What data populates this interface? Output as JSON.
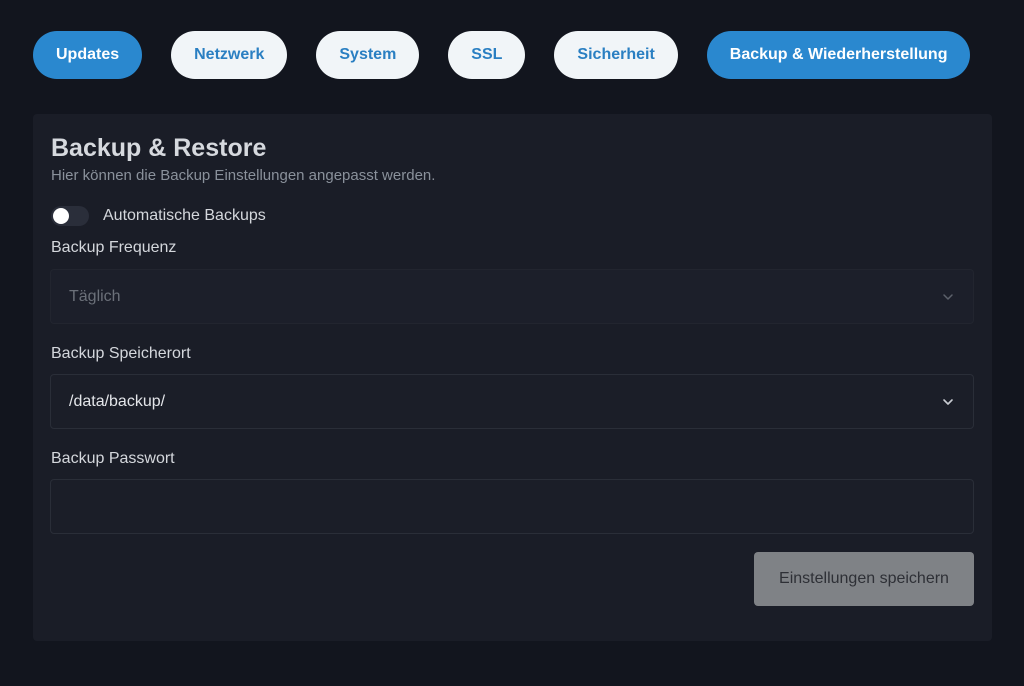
{
  "tabs": [
    {
      "label": "Updates",
      "style": "filled"
    },
    {
      "label": "Netzwerk",
      "style": "outline"
    },
    {
      "label": "System",
      "style": "outline"
    },
    {
      "label": "SSL",
      "style": "outline"
    },
    {
      "label": "Sicherheit",
      "style": "outline"
    },
    {
      "label": "Backup & Wiederherstellung",
      "style": "filled"
    }
  ],
  "card": {
    "title": "Backup & Restore",
    "subtitle": "Hier können die Backup Einstellungen angepasst werden.",
    "auto_backup": {
      "label": "Automatische Backups",
      "enabled": false,
      "icon": "toggle-switch-icon"
    },
    "frequency": {
      "label": "Backup Frequenz",
      "value": "Täglich",
      "disabled": true,
      "icon": "chevron-down-icon"
    },
    "location": {
      "label": "Backup Speicherort",
      "value": "/data/backup/",
      "icon": "chevron-down-icon"
    },
    "password": {
      "label": "Backup Passwort",
      "value": "",
      "placeholder": ""
    },
    "save_label": "Einstellungen speichern"
  },
  "colors": {
    "background": "#12151e",
    "card": "#1a1d27",
    "accent": "#2a88cf",
    "tab_outline_bg": "#f1f5f8",
    "tab_outline_text": "#2a7fc2",
    "button_disabled": "#7f8286"
  }
}
